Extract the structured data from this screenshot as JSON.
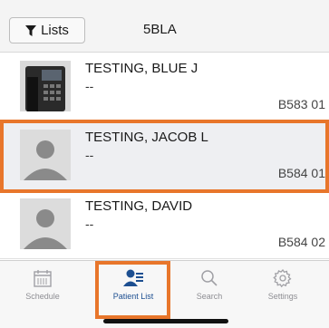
{
  "header": {
    "lists_label": "Lists",
    "unit_title": "5BLA"
  },
  "patients": [
    {
      "name": "TESTING, BLUE J",
      "sub": "--",
      "bed": "B583 01",
      "photo": "phone-photo",
      "selected": false
    },
    {
      "name": "TESTING, JACOB L",
      "sub": "--",
      "bed": "B584 01",
      "photo": "placeholder-avatar",
      "selected": true
    },
    {
      "name": "TESTING, DAVID",
      "sub": "--",
      "bed": "B584 02",
      "photo": "placeholder-avatar",
      "selected": false
    }
  ],
  "tabbar": {
    "tabs": [
      {
        "label": "Schedule",
        "icon": "calendar-icon",
        "active": false
      },
      {
        "label": "Patient List",
        "icon": "patient-list-icon",
        "active": true
      },
      {
        "label": "Search",
        "icon": "search-icon",
        "active": false
      },
      {
        "label": "Settings",
        "icon": "gear-icon",
        "active": false
      }
    ]
  },
  "colors": {
    "highlight": "#e8762b",
    "active_tab": "#1d4f91",
    "inactive_tab": "#8e8e93",
    "selected_row": "#eeeff2"
  }
}
